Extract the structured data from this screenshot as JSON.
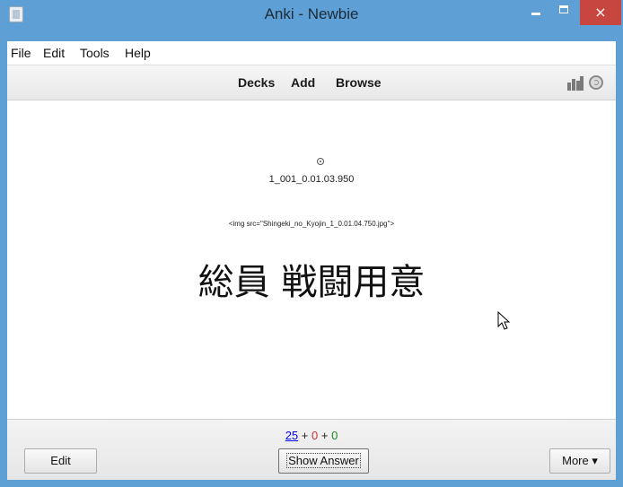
{
  "window": {
    "title": "Anki - Newbie",
    "close_glyph": "×"
  },
  "menu": [
    "File",
    "Edit",
    "Tools",
    "Help"
  ],
  "toolbar": {
    "decks": "Decks",
    "add": "Add",
    "browse": "Browse"
  },
  "card": {
    "filename": "1_001_0.01.03.950",
    "img_tag": "<img src=\"Shingeki_no_Kyojin_1_0.01.04.750.jpg\">",
    "text": "総員 戦闘用意"
  },
  "counts": {
    "new": "25",
    "learn": "0",
    "review": "0",
    "plus": "+"
  },
  "buttons": {
    "edit": "Edit",
    "show_answer": "Show Answer",
    "more": "More ▾"
  },
  "icons": {
    "app": "anki-app-icon",
    "stats": "stats-icon",
    "sync": "sync-icon",
    "audio": "audio-play-icon",
    "cursor": "mouse-cursor-icon"
  },
  "colors": {
    "titlebar": "#5ea0d6",
    "close": "#c7463f",
    "new_count": "#0000ee",
    "learn_count": "#cc3333",
    "review_count": "#1a8c1a"
  }
}
